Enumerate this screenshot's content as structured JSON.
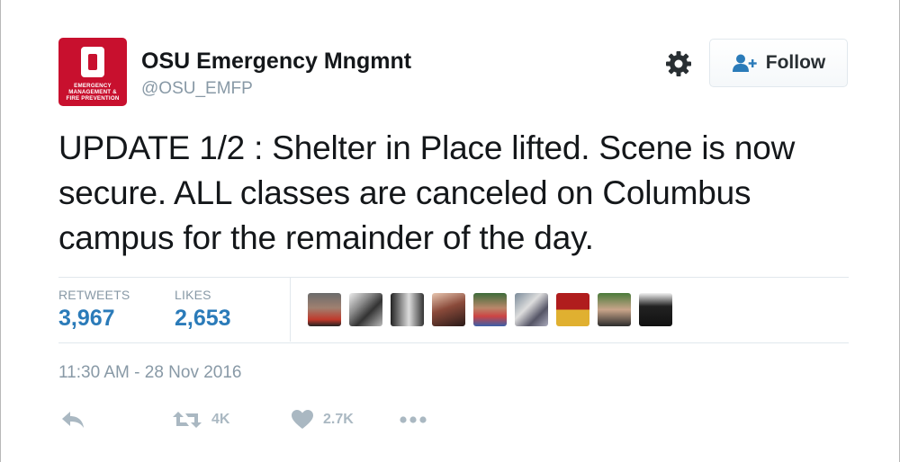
{
  "account": {
    "name": "OSU Emergency Mngmnt",
    "handle": "@OSU_EMFP",
    "avatar_text": [
      "EMERGENCY",
      "MANAGEMENT &",
      "FIRE PREVENTION"
    ],
    "brand_color": "#c8102e"
  },
  "header": {
    "settings_icon": "gear-icon",
    "follow_label": "Follow",
    "follow_icon": "add-person-icon"
  },
  "tweet": {
    "text": "UPDATE 1/2 : Shelter in Place lifted. Scene is now secure. ALL classes are canceled on Columbus campus for the remainder of the day.",
    "timestamp": "11:30 AM - 28 Nov 2016"
  },
  "stats": {
    "retweets_label": "RETWEETS",
    "retweets_value": "3,967",
    "likes_label": "LIKES",
    "likes_value": "2,653",
    "value_color": "#2b7bb9"
  },
  "likers": [
    "liker-avatar-1",
    "liker-avatar-2",
    "liker-avatar-3",
    "liker-avatar-4",
    "liker-avatar-5",
    "liker-avatar-6",
    "liker-avatar-7",
    "liker-avatar-8",
    "liker-avatar-9"
  ],
  "actions": {
    "reply_icon": "reply-icon",
    "retweet_icon": "retweet-icon",
    "retweet_count": "4K",
    "like_icon": "heart-icon",
    "like_count": "2.7K",
    "more_icon": "more-dots-icon"
  }
}
